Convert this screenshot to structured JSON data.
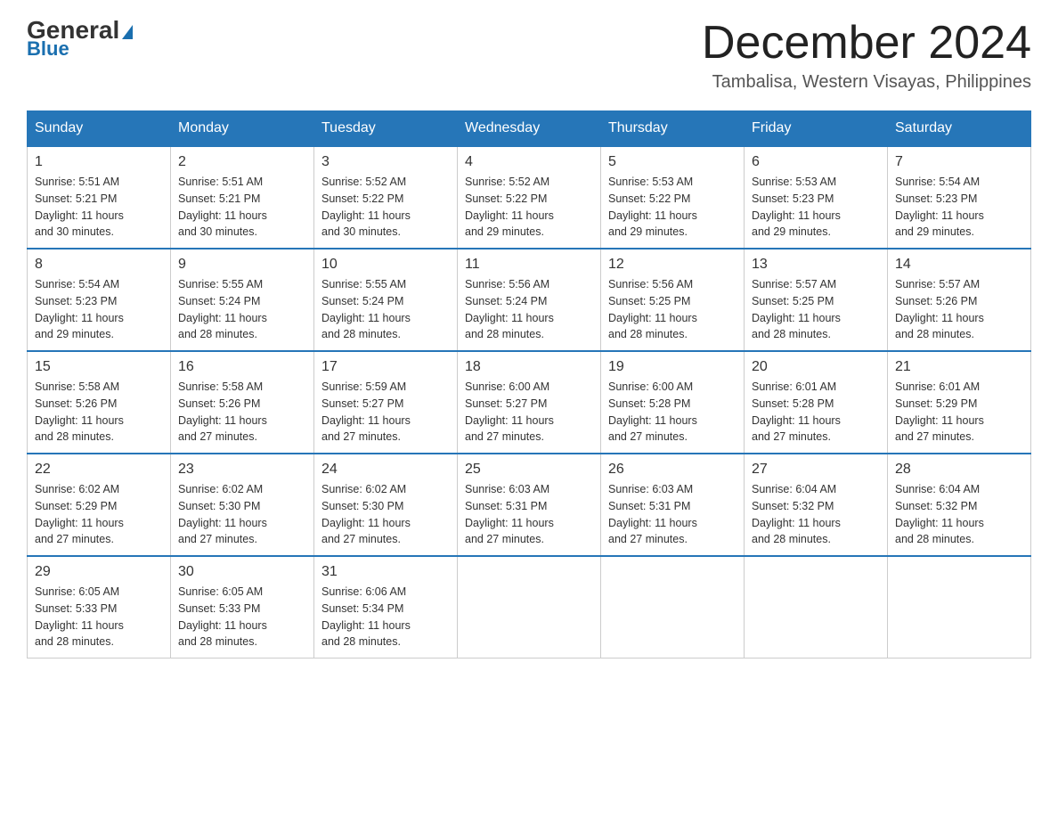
{
  "header": {
    "logo_general": "General",
    "logo_blue": "Blue",
    "month_title": "December 2024",
    "location": "Tambalisa, Western Visayas, Philippines"
  },
  "weekdays": [
    "Sunday",
    "Monday",
    "Tuesday",
    "Wednesday",
    "Thursday",
    "Friday",
    "Saturday"
  ],
  "weeks": [
    [
      {
        "day": "1",
        "sunrise": "5:51 AM",
        "sunset": "5:21 PM",
        "daylight": "11 hours and 30 minutes."
      },
      {
        "day": "2",
        "sunrise": "5:51 AM",
        "sunset": "5:21 PM",
        "daylight": "11 hours and 30 minutes."
      },
      {
        "day": "3",
        "sunrise": "5:52 AM",
        "sunset": "5:22 PM",
        "daylight": "11 hours and 30 minutes."
      },
      {
        "day": "4",
        "sunrise": "5:52 AM",
        "sunset": "5:22 PM",
        "daylight": "11 hours and 29 minutes."
      },
      {
        "day": "5",
        "sunrise": "5:53 AM",
        "sunset": "5:22 PM",
        "daylight": "11 hours and 29 minutes."
      },
      {
        "day": "6",
        "sunrise": "5:53 AM",
        "sunset": "5:23 PM",
        "daylight": "11 hours and 29 minutes."
      },
      {
        "day": "7",
        "sunrise": "5:54 AM",
        "sunset": "5:23 PM",
        "daylight": "11 hours and 29 minutes."
      }
    ],
    [
      {
        "day": "8",
        "sunrise": "5:54 AM",
        "sunset": "5:23 PM",
        "daylight": "11 hours and 29 minutes."
      },
      {
        "day": "9",
        "sunrise": "5:55 AM",
        "sunset": "5:24 PM",
        "daylight": "11 hours and 28 minutes."
      },
      {
        "day": "10",
        "sunrise": "5:55 AM",
        "sunset": "5:24 PM",
        "daylight": "11 hours and 28 minutes."
      },
      {
        "day": "11",
        "sunrise": "5:56 AM",
        "sunset": "5:24 PM",
        "daylight": "11 hours and 28 minutes."
      },
      {
        "day": "12",
        "sunrise": "5:56 AM",
        "sunset": "5:25 PM",
        "daylight": "11 hours and 28 minutes."
      },
      {
        "day": "13",
        "sunrise": "5:57 AM",
        "sunset": "5:25 PM",
        "daylight": "11 hours and 28 minutes."
      },
      {
        "day": "14",
        "sunrise": "5:57 AM",
        "sunset": "5:26 PM",
        "daylight": "11 hours and 28 minutes."
      }
    ],
    [
      {
        "day": "15",
        "sunrise": "5:58 AM",
        "sunset": "5:26 PM",
        "daylight": "11 hours and 28 minutes."
      },
      {
        "day": "16",
        "sunrise": "5:58 AM",
        "sunset": "5:26 PM",
        "daylight": "11 hours and 27 minutes."
      },
      {
        "day": "17",
        "sunrise": "5:59 AM",
        "sunset": "5:27 PM",
        "daylight": "11 hours and 27 minutes."
      },
      {
        "day": "18",
        "sunrise": "6:00 AM",
        "sunset": "5:27 PM",
        "daylight": "11 hours and 27 minutes."
      },
      {
        "day": "19",
        "sunrise": "6:00 AM",
        "sunset": "5:28 PM",
        "daylight": "11 hours and 27 minutes."
      },
      {
        "day": "20",
        "sunrise": "6:01 AM",
        "sunset": "5:28 PM",
        "daylight": "11 hours and 27 minutes."
      },
      {
        "day": "21",
        "sunrise": "6:01 AM",
        "sunset": "5:29 PM",
        "daylight": "11 hours and 27 minutes."
      }
    ],
    [
      {
        "day": "22",
        "sunrise": "6:02 AM",
        "sunset": "5:29 PM",
        "daylight": "11 hours and 27 minutes."
      },
      {
        "day": "23",
        "sunrise": "6:02 AM",
        "sunset": "5:30 PM",
        "daylight": "11 hours and 27 minutes."
      },
      {
        "day": "24",
        "sunrise": "6:02 AM",
        "sunset": "5:30 PM",
        "daylight": "11 hours and 27 minutes."
      },
      {
        "day": "25",
        "sunrise": "6:03 AM",
        "sunset": "5:31 PM",
        "daylight": "11 hours and 27 minutes."
      },
      {
        "day": "26",
        "sunrise": "6:03 AM",
        "sunset": "5:31 PM",
        "daylight": "11 hours and 27 minutes."
      },
      {
        "day": "27",
        "sunrise": "6:04 AM",
        "sunset": "5:32 PM",
        "daylight": "11 hours and 28 minutes."
      },
      {
        "day": "28",
        "sunrise": "6:04 AM",
        "sunset": "5:32 PM",
        "daylight": "11 hours and 28 minutes."
      }
    ],
    [
      {
        "day": "29",
        "sunrise": "6:05 AM",
        "sunset": "5:33 PM",
        "daylight": "11 hours and 28 minutes."
      },
      {
        "day": "30",
        "sunrise": "6:05 AM",
        "sunset": "5:33 PM",
        "daylight": "11 hours and 28 minutes."
      },
      {
        "day": "31",
        "sunrise": "6:06 AM",
        "sunset": "5:34 PM",
        "daylight": "11 hours and 28 minutes."
      },
      null,
      null,
      null,
      null
    ]
  ],
  "labels": {
    "sunrise": "Sunrise:",
    "sunset": "Sunset:",
    "daylight": "Daylight:"
  }
}
